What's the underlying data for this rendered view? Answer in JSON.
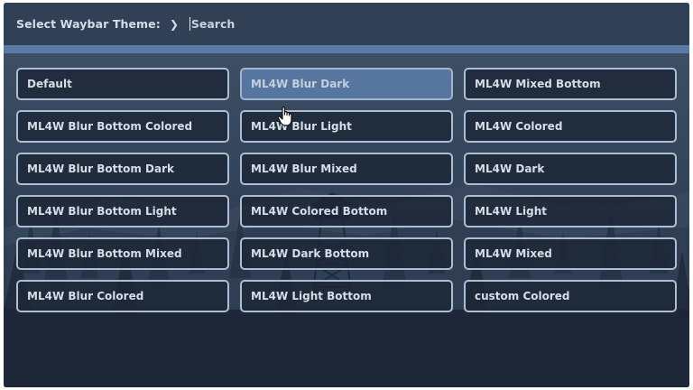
{
  "prompt": {
    "label": "Select Waybar Theme:",
    "chevron": "❯",
    "search_placeholder": "Search"
  },
  "themes": [
    {
      "label": "Default",
      "selected": false
    },
    {
      "label": "ML4W Blur Dark",
      "selected": true
    },
    {
      "label": "ML4W Mixed Bottom",
      "selected": false
    },
    {
      "label": "ML4W Blur Bottom Colored",
      "selected": false
    },
    {
      "label": "ML4W Blur Light",
      "selected": false
    },
    {
      "label": "ML4W Colored",
      "selected": false
    },
    {
      "label": "ML4W Blur Bottom Dark",
      "selected": false
    },
    {
      "label": "ML4W Blur Mixed",
      "selected": false
    },
    {
      "label": "ML4W Dark",
      "selected": false
    },
    {
      "label": "ML4W Blur Bottom Light",
      "selected": false
    },
    {
      "label": "ML4W Colored Bottom",
      "selected": false
    },
    {
      "label": "ML4W Light",
      "selected": false
    },
    {
      "label": "ML4W Blur Bottom Mixed",
      "selected": false
    },
    {
      "label": "ML4W Dark Bottom",
      "selected": false
    },
    {
      "label": "ML4W Mixed",
      "selected": false
    },
    {
      "label": "ML4W Blur Colored",
      "selected": false
    },
    {
      "label": "ML4W Light Bottom",
      "selected": false
    },
    {
      "label": "custom Colored",
      "selected": false
    }
  ],
  "colors": {
    "topbar": "#324055",
    "accent": "#5a7aa5",
    "item_border": "#aebed2",
    "item_selected": "#5676a0",
    "text": "#d5dde7"
  },
  "icons": {
    "cursor": "hand-pointer-icon"
  }
}
